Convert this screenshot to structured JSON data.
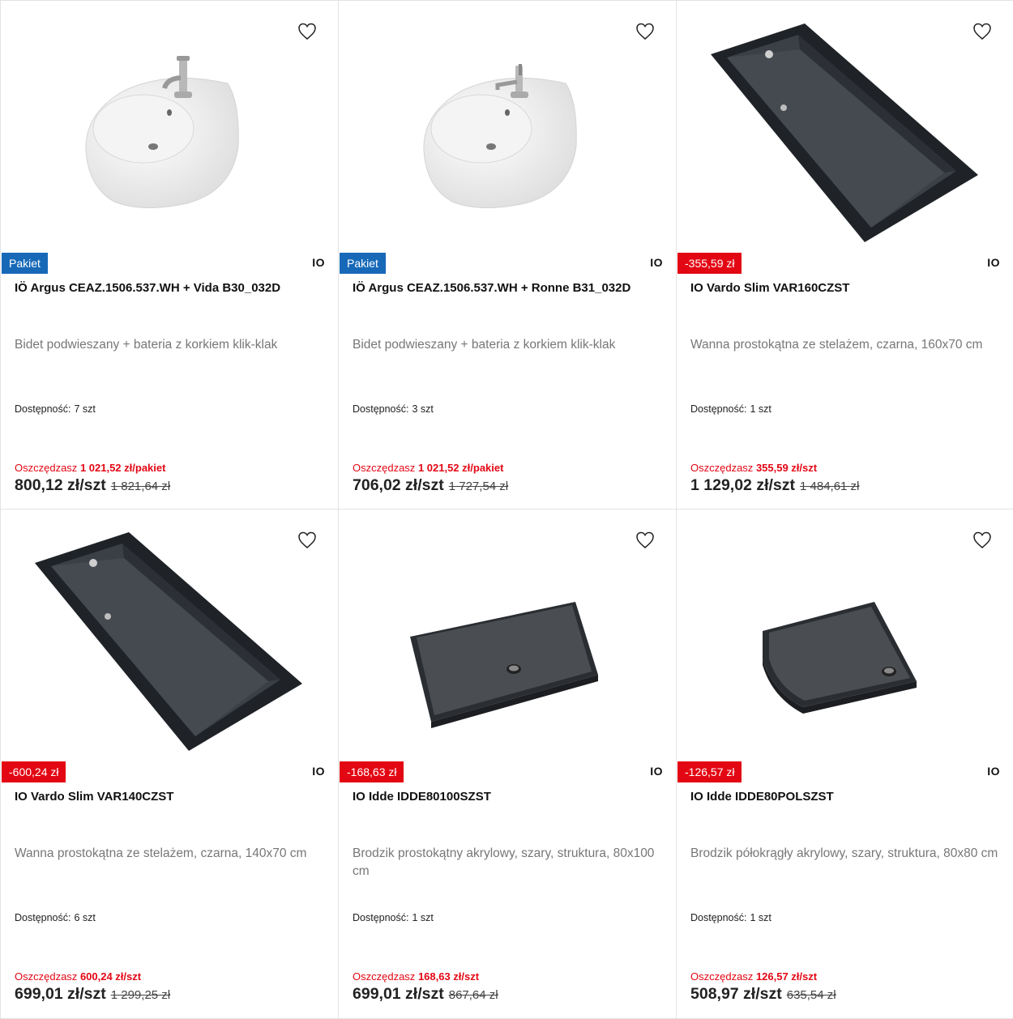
{
  "products": [
    {
      "badge": "Pakiet",
      "brand": "IO",
      "name": "IÖ Argus CEAZ.1506.537.WH + Vida B30_032D",
      "description": "Bidet podwieszany + bateria z korkiem klik-klak",
      "availability_label": "Dostępność:",
      "availability_value": "7 szt",
      "save_label": "Oszczędzasz",
      "save_amount": "1 021,52 zł/pakiet",
      "price": "800,12 zł/szt",
      "old_price": "1 821,64 zł",
      "image": "bidet-with-faucet"
    },
    {
      "badge": "Pakiet",
      "brand": "IO",
      "name": "IÖ Argus CEAZ.1506.537.WH + Ronne B31_032D",
      "description": "Bidet podwieszany + bateria z korkiem klik-klak",
      "availability_label": "Dostępność:",
      "availability_value": "3 szt",
      "save_label": "Oszczędzasz",
      "save_amount": "1 021,52 zł/pakiet",
      "price": "706,02 zł/szt",
      "old_price": "1 727,54 zł",
      "image": "bidet-with-faucet"
    },
    {
      "badge": "-355,59 zł",
      "brand": "IO",
      "name": "IO Vardo Slim VAR160CZST",
      "description": "Wanna prostokątna ze stelażem, czarna, 160x70 cm",
      "availability_label": "Dostępność:",
      "availability_value": "1 szt",
      "save_label": "Oszczędzasz",
      "save_amount": "355,59 zł/szt",
      "price": "1 129,02 zł/szt",
      "old_price": "1 484,61 zł",
      "image": "black-bathtub"
    },
    {
      "badge": "-600,24 zł",
      "brand": "IO",
      "name": "IO Vardo Slim VAR140CZST",
      "description": "Wanna prostokątna ze stelażem, czarna, 140x70 cm",
      "availability_label": "Dostępność:",
      "availability_value": "6 szt",
      "save_label": "Oszczędzasz",
      "save_amount": "600,24 zł/szt",
      "price": "699,01 zł/szt",
      "old_price": "1 299,25 zł",
      "image": "black-bathtub"
    },
    {
      "badge": "-168,63 zł",
      "brand": "IO",
      "name": "IO Idde IDDE80100SZST",
      "description": "Brodzik prostokątny akrylowy, szary, struktura, 80x100 cm",
      "availability_label": "Dostępność:",
      "availability_value": "1 szt",
      "save_label": "Oszczędzasz",
      "save_amount": "168,63 zł/szt",
      "price": "699,01 zł/szt",
      "old_price": "867,64 zł",
      "image": "rectangular-shower-tray"
    },
    {
      "badge": "-126,57 zł",
      "brand": "IO",
      "name": "IO Idde IDDE80POLSZST",
      "description": "Brodzik półokrągły akrylowy, szary, struktura, 80x80 cm",
      "availability_label": "Dostępność:",
      "availability_value": "1 szt",
      "save_label": "Oszczędzasz",
      "save_amount": "126,57 zł/szt",
      "price": "508,97 zł/szt",
      "old_price": "635,54 zł",
      "image": "quadrant-shower-tray"
    }
  ],
  "colors": {
    "package_badge": "#1769b8",
    "discount_badge": "#e30613",
    "savings_text": "#e30613"
  }
}
